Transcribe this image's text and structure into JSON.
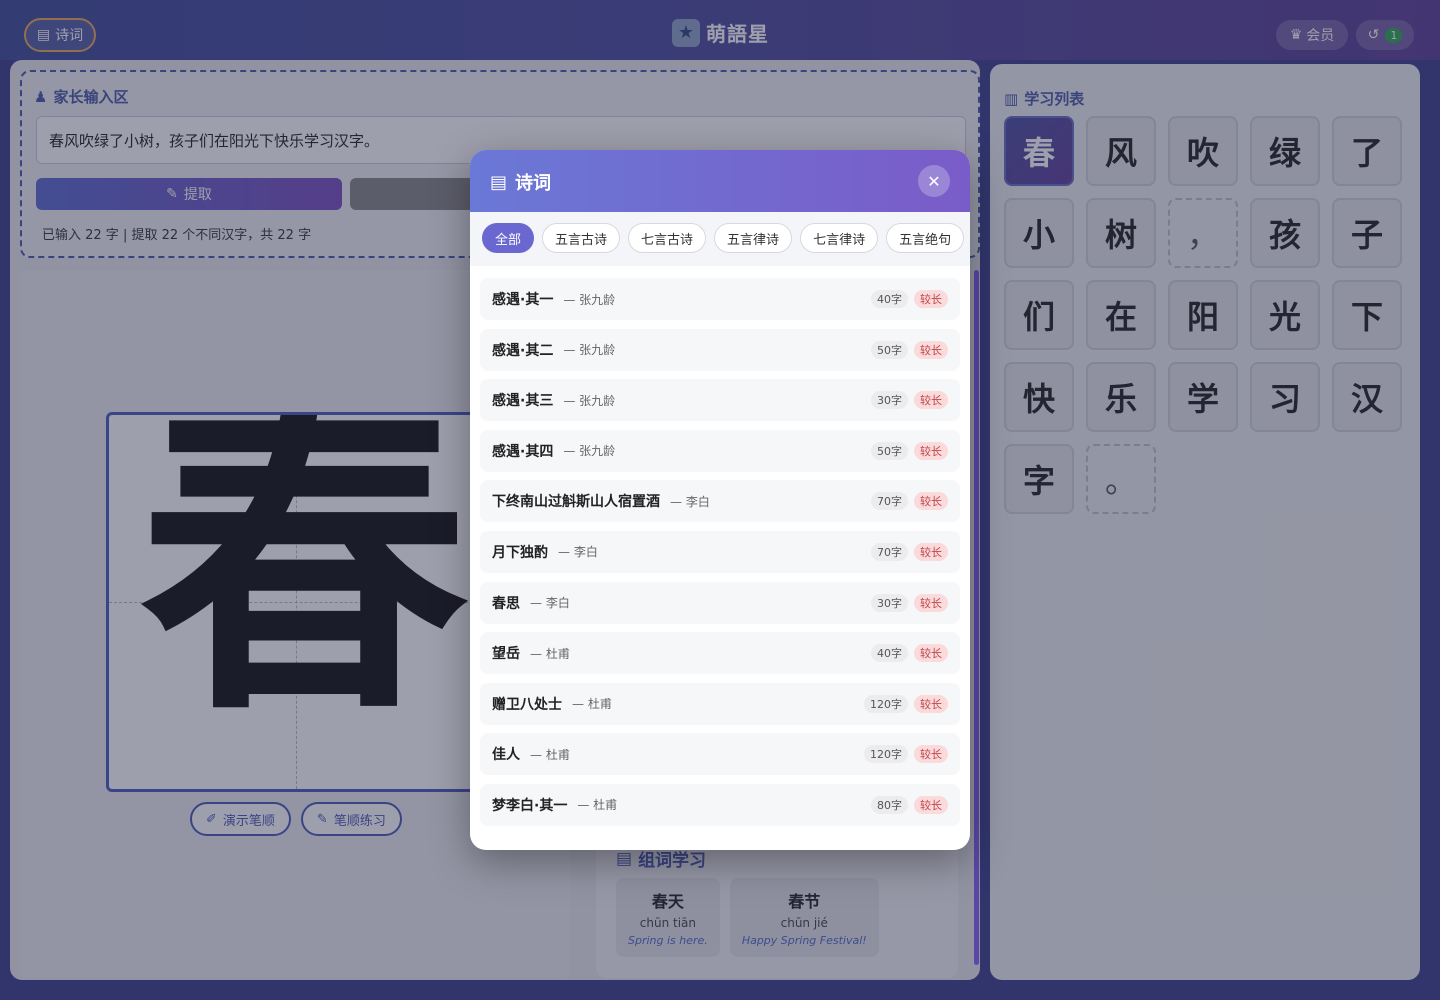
{
  "header": {
    "poem_button": "诗词",
    "logo_text": "萌語星",
    "vip_label": "会员",
    "history_count": "1"
  },
  "input": {
    "section_title": "家长输入区",
    "text": "春风吹绿了小树，孩子们在阳光下快乐学习汉字。",
    "extract_label": "提取",
    "stats": "已输入 22 字 | 提取 22 个不同汉字，共 22 字"
  },
  "practice": {
    "current_char": "春",
    "demo_label": "演示笔顺",
    "practice_label": "笔顺练习"
  },
  "words": {
    "title": "组词学习",
    "items": [
      {
        "word": "春天",
        "pinyin": "chūn tiān",
        "english": "Spring is here."
      },
      {
        "word": "春节",
        "pinyin": "chūn jié",
        "english": "Happy Spring Festival!"
      }
    ]
  },
  "learning_list": {
    "title": "学习列表",
    "chars": [
      "春",
      "风",
      "吹",
      "绿",
      "了",
      "小",
      "树",
      "，",
      "孩",
      "子",
      "们",
      "在",
      "阳",
      "光",
      "下",
      "快",
      "乐",
      "学",
      "习",
      "汉",
      "字",
      "。"
    ]
  },
  "modal": {
    "title": "诗词",
    "tabs": [
      "全部",
      "五言古诗",
      "七言古诗",
      "五言律诗",
      "七言律诗",
      "五言绝句"
    ],
    "poems": [
      {
        "name": "感遇·其一",
        "author": "— 张九龄",
        "length": "40字",
        "tag": "较长"
      },
      {
        "name": "感遇·其二",
        "author": "— 张九龄",
        "length": "50字",
        "tag": "较长"
      },
      {
        "name": "感遇·其三",
        "author": "— 张九龄",
        "length": "30字",
        "tag": "较长"
      },
      {
        "name": "感遇·其四",
        "author": "— 张九龄",
        "length": "50字",
        "tag": "较长"
      },
      {
        "name": "下终南山过斛斯山人宿置酒",
        "author": "— 李白",
        "length": "70字",
        "tag": "较长"
      },
      {
        "name": "月下独酌",
        "author": "— 李白",
        "length": "70字",
        "tag": "较长"
      },
      {
        "name": "春思",
        "author": "— 李白",
        "length": "30字",
        "tag": "较长"
      },
      {
        "name": "望岳",
        "author": "— 杜甫",
        "length": "40字",
        "tag": "较长"
      },
      {
        "name": "赠卫八处士",
        "author": "— 杜甫",
        "length": "120字",
        "tag": "较长"
      },
      {
        "name": "佳人",
        "author": "— 杜甫",
        "length": "120字",
        "tag": "较长"
      },
      {
        "name": "梦李白·其一",
        "author": "— 杜甫",
        "length": "80字",
        "tag": "较长"
      }
    ]
  }
}
